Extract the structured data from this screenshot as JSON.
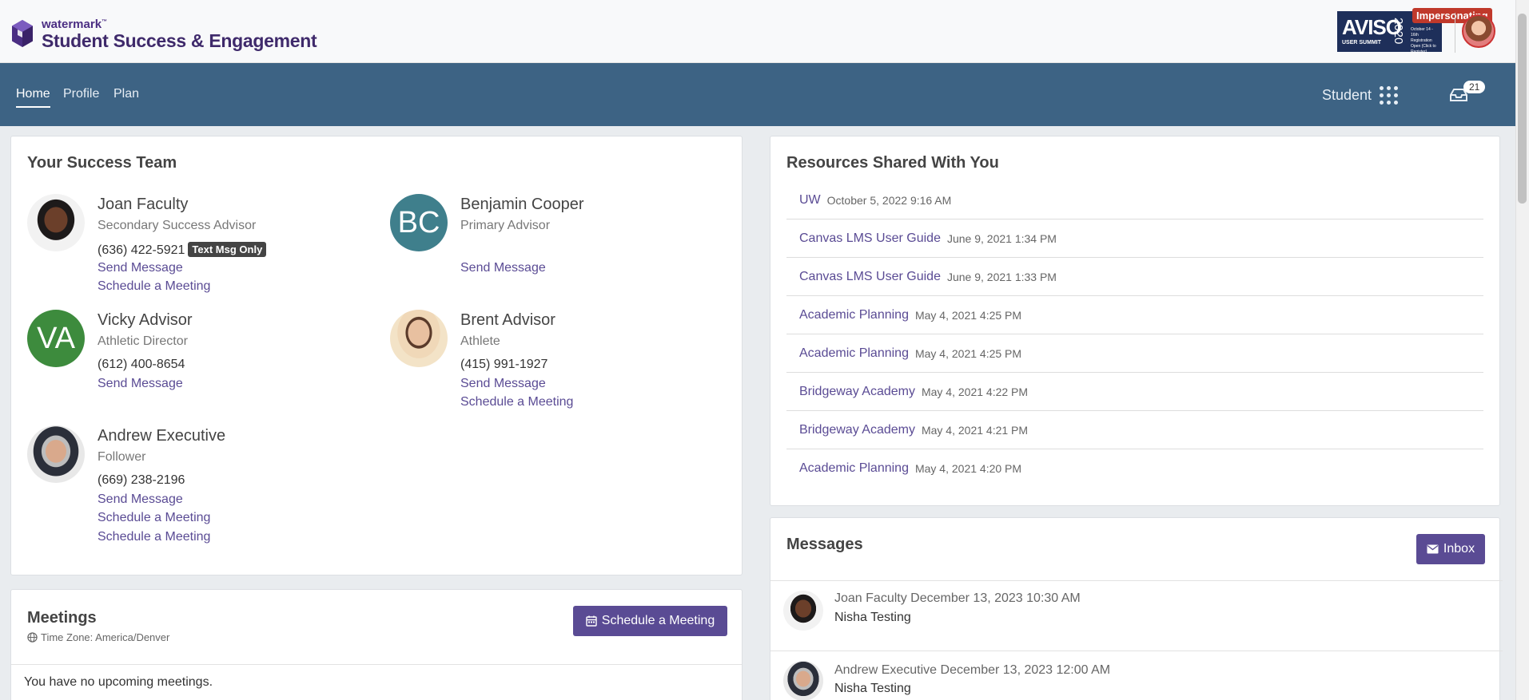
{
  "brand": {
    "small": "watermark",
    "trademark": "™",
    "title": "Student Success & Engagement",
    "colors": {
      "primary": "#5a4b94",
      "nav": "#3d6384",
      "badge": "#c0392b"
    }
  },
  "banner": {
    "line1": "AVISO",
    "line2": "USER SUMMIT",
    "year": "2020",
    "note": "October 14 - 16th Registration Open (Click to Register)"
  },
  "impersonating_label": "Impersonating",
  "nav": {
    "items": [
      {
        "label": "Home",
        "active": true
      },
      {
        "label": "Profile",
        "active": false
      },
      {
        "label": "Plan",
        "active": false
      }
    ],
    "role_label": "Student",
    "role_icon": "apps-grid-icon",
    "inbox_icon": "inbox-icon",
    "inbox_count": "21"
  },
  "success_team": {
    "title": "Your Success Team",
    "members": [
      {
        "name": "Joan Faculty",
        "role": "Secondary Success Advisor",
        "phone": "(636) 422-5921",
        "badge": "Text Msg Only",
        "links": [
          "Send Message",
          "Schedule a Meeting"
        ]
      },
      {
        "name": "Benjamin Cooper",
        "role": "Primary Advisor",
        "initials": "BC",
        "initials_color": "#3f7f8c",
        "links": [
          "Send Message"
        ]
      },
      {
        "name": "Vicky Advisor",
        "role": "Athletic Director",
        "initials": "VA",
        "initials_color": "#3d8b3d",
        "phone": "(612) 400-8654",
        "links": [
          "Send Message"
        ]
      },
      {
        "name": "Brent Advisor",
        "role": "Athlete",
        "phone": "(415) 991-1927",
        "links": [
          "Send Message",
          "Schedule a Meeting"
        ]
      },
      {
        "name": "Andrew Executive",
        "role": "Follower",
        "phone": "(669) 238-2196",
        "links": [
          "Send Message",
          "Schedule a Meeting",
          "Schedule a Meeting"
        ]
      }
    ]
  },
  "meetings": {
    "title": "Meetings",
    "timezone": "Time Zone: America/Denver",
    "button": "Schedule a Meeting",
    "empty": "You have no upcoming meetings."
  },
  "resources": {
    "title": "Resources Shared With You",
    "items": [
      {
        "label": "UW",
        "date": "October 5, 2022 9:16 AM"
      },
      {
        "label": "Canvas LMS User Guide",
        "date": "June 9, 2021 1:34 PM"
      },
      {
        "label": "Canvas LMS User Guide",
        "date": "June 9, 2021 1:33 PM"
      },
      {
        "label": "Academic Planning",
        "date": "May 4, 2021 4:25 PM"
      },
      {
        "label": "Academic Planning",
        "date": "May 4, 2021 4:25 PM"
      },
      {
        "label": "Bridgeway Academy",
        "date": "May 4, 2021 4:22 PM"
      },
      {
        "label": "Bridgeway Academy",
        "date": "May 4, 2021 4:21 PM"
      },
      {
        "label": "Academic Planning",
        "date": "May 4, 2021 4:20 PM"
      }
    ]
  },
  "messages": {
    "title": "Messages",
    "button": "Inbox",
    "items": [
      {
        "sender": "Joan Faculty",
        "date": "December 13, 2023 10:30 AM",
        "subject": "Nisha Testing"
      },
      {
        "sender": "Andrew Executive",
        "date": "December 13, 2023 12:00 AM",
        "subject": "Nisha Testing"
      }
    ]
  }
}
